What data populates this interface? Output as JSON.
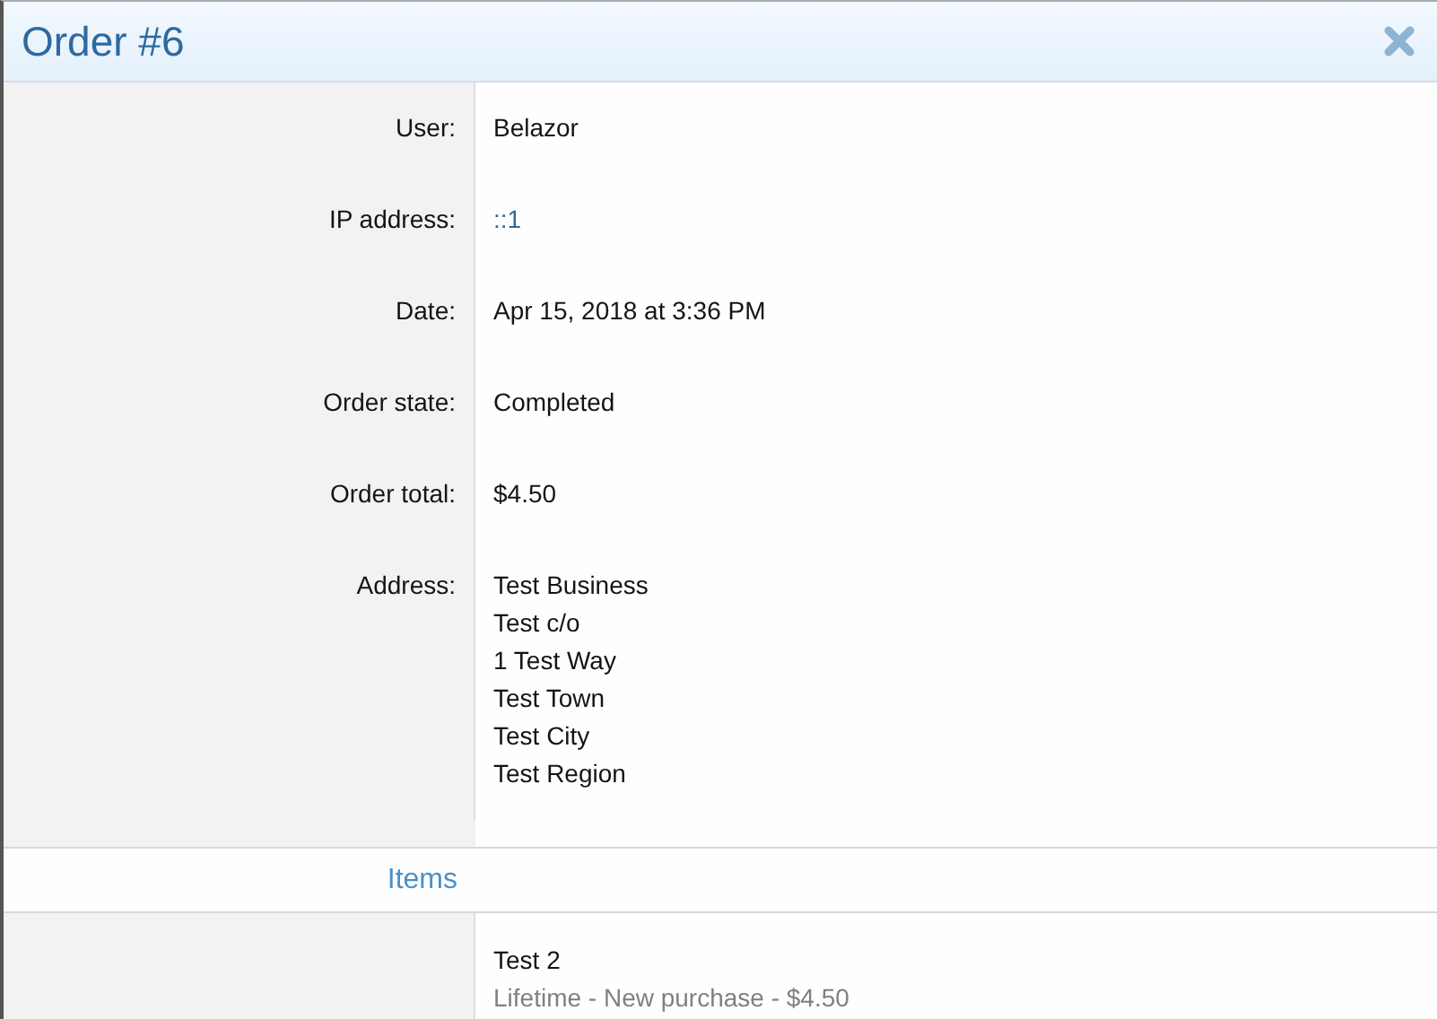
{
  "title": "Order #6",
  "fields": [
    {
      "label": "User:",
      "kind": "text",
      "lines": [
        "Belazor"
      ]
    },
    {
      "label": "IP address:",
      "kind": "link",
      "lines": [
        "::1"
      ]
    },
    {
      "label": "Date:",
      "kind": "text",
      "lines": [
        "Apr 15, 2018 at 3:36 PM"
      ]
    },
    {
      "label": "Order state:",
      "kind": "text",
      "lines": [
        "Completed"
      ]
    },
    {
      "label": "Order total:",
      "kind": "text",
      "lines": [
        "$4.50"
      ]
    },
    {
      "label": "Address:",
      "kind": "text",
      "lines": [
        "Test Business",
        "Test c/o",
        "1 Test Way",
        "Test Town",
        "Test City",
        "Test Region"
      ]
    }
  ],
  "items_heading": "Items",
  "items": [
    {
      "name": "Test 2",
      "detail": "Lifetime - New purchase - $4.50"
    }
  ]
}
